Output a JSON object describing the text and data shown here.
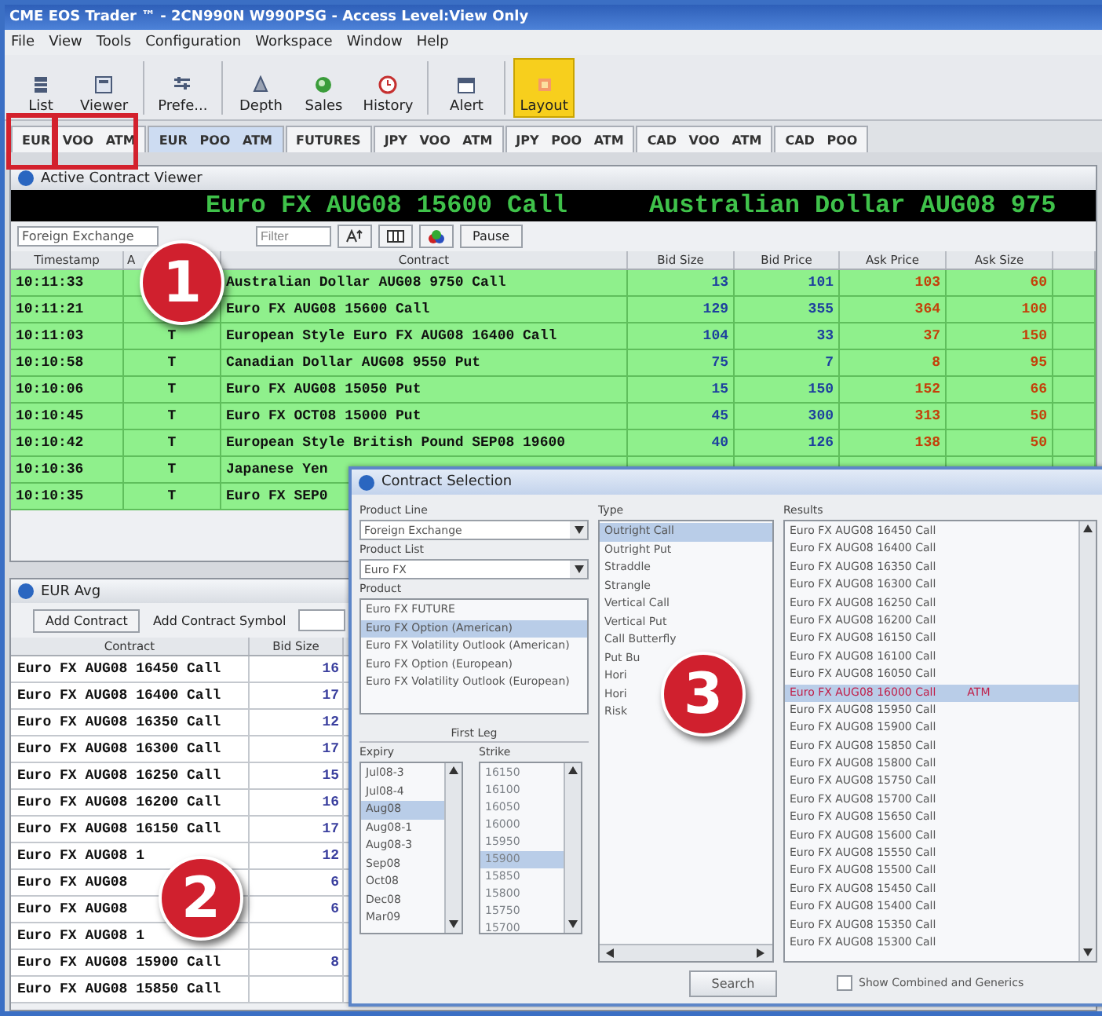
{
  "window": {
    "title": "CME EOS Trader ™ - 2CN990N W990PSG - Access Level:View Only"
  },
  "menu": [
    "File",
    "View",
    "Tools",
    "Configuration",
    "Workspace",
    "Window",
    "Help"
  ],
  "toolbar": [
    {
      "label": "List",
      "kind": "list",
      "selected": false
    },
    {
      "label": "Viewer",
      "kind": "viewer",
      "selected": false
    },
    {
      "label": "Prefe...",
      "kind": "prefs",
      "selected": false
    },
    {
      "label": "Depth",
      "kind": "depth",
      "selected": false
    },
    {
      "label": "Sales",
      "kind": "sales",
      "selected": false
    },
    {
      "label": "History",
      "kind": "history",
      "selected": false
    },
    {
      "label": "Alert",
      "kind": "alert",
      "selected": false
    },
    {
      "label": "Layout",
      "kind": "layout",
      "selected": true
    }
  ],
  "tabs": [
    {
      "label": "EUR VOO ATM",
      "selected": false
    },
    {
      "label": "EUR POO ATM",
      "selected": true
    },
    {
      "label": "FUTURES",
      "selected": false
    },
    {
      "label": "JPY VOO ATM",
      "selected": false
    },
    {
      "label": "JPY POO ATM",
      "selected": false
    },
    {
      "label": "CAD VOO ATM",
      "selected": false
    },
    {
      "label": "CAD POO",
      "selected": false
    }
  ],
  "callouts": [
    "1",
    "2",
    "3"
  ],
  "contract_viewer": {
    "title": "Active Contract Viewer",
    "ticker": [
      "Euro FX AUG08 15600 Call",
      "Australian Dollar AUG08 975"
    ],
    "product_line": "Foreign Exchange",
    "filter": {
      "placeholder": "Filter"
    },
    "pause_button": "Pause",
    "columns": [
      "Timestamp",
      "A",
      "Contract",
      "Bid Size",
      "Bid Price",
      "Ask Price",
      "Ask Size"
    ],
    "rows": [
      {
        "timestamp": "10:11:33",
        "contract": "Australian Dollar AUG08 9750 Call",
        "bid_size": "13",
        "bid_price": "101",
        "ask_price": "103",
        "ask_size": "60"
      },
      {
        "timestamp": "10:11:21",
        "contract": "Euro FX AUG08 15600 Call",
        "bid_size": "129",
        "bid_price": "355",
        "ask_price": "364",
        "ask_size": "100"
      },
      {
        "timestamp": "10:11:03",
        "action": "T",
        "contract": "European Style Euro FX AUG08 16400 Call",
        "bid_size": "104",
        "bid_price": "33",
        "ask_price": "37",
        "ask_size": "150"
      },
      {
        "timestamp": "10:10:58",
        "action": "T",
        "contract": "Canadian Dollar AUG08 9550 Put",
        "bid_size": "75",
        "bid_price": "7",
        "ask_price": "8",
        "ask_size": "95"
      },
      {
        "timestamp": "10:10:06",
        "action": "T",
        "contract": "Euro FX AUG08 15050 Put",
        "bid_size": "15",
        "bid_price": "150",
        "ask_price": "152",
        "ask_size": "66"
      },
      {
        "timestamp": "10:10:45",
        "action": "T",
        "contract": "Euro FX OCT08 15000 Put",
        "bid_size": "45",
        "bid_price": "300",
        "ask_price": "313",
        "ask_size": "50"
      },
      {
        "timestamp": "10:10:42",
        "action": "T",
        "contract": "European Style British Pound SEP08 19600",
        "bid_size": "40",
        "bid_price": "126",
        "ask_price": "138",
        "ask_size": "50"
      },
      {
        "timestamp": "10:10:36",
        "action": "T",
        "contract": "Japanese Yen"
      },
      {
        "timestamp": "10:10:35",
        "action": "T",
        "contract": "Euro FX SEP0"
      }
    ]
  },
  "eur_avg": {
    "title": "EUR Avg",
    "add_contract_button": "Add Contract",
    "add_symbol_label": "Add Contract Symbol",
    "columns": [
      "Contract",
      "Bid Size"
    ],
    "rows": [
      {
        "contract": "Euro FX AUG08 16450 Call",
        "bid_size": "16"
      },
      {
        "contract": "Euro FX AUG08 16400 Call",
        "bid_size": "17"
      },
      {
        "contract": "Euro FX AUG08 16350 Call",
        "bid_size": "12"
      },
      {
        "contract": "Euro FX AUG08 16300 Call",
        "bid_size": "17"
      },
      {
        "contract": "Euro FX AUG08 16250 Call",
        "bid_size": "15"
      },
      {
        "contract": "Euro FX AUG08 16200 Call",
        "bid_size": "16"
      },
      {
        "contract": "Euro FX AUG08 16150 Call",
        "bid_size": "17"
      },
      {
        "contract": "Euro FX AUG08 1",
        "bid_size": "12"
      },
      {
        "contract": "Euro FX AUG08",
        "bid_size": "6"
      },
      {
        "contract": "Euro FX AUG08",
        "bid_size": "6"
      },
      {
        "contract": "Euro FX AUG08 1"
      },
      {
        "contract": "Euro FX AUG08 15900 Call",
        "bid_size": "8"
      },
      {
        "contract": "Euro FX AUG08 15850 Call"
      }
    ]
  },
  "contract_selection": {
    "title": "Contract Selection",
    "product_line_label": "Product Line",
    "product_line": "Foreign Exchange",
    "product_list_label": "Product List",
    "product_list": "Euro FX",
    "product_label": "Product",
    "products": [
      {
        "label": "Euro FX FUTURE",
        "selected": false
      },
      {
        "label": "Euro FX Option (American)",
        "selected": true
      },
      {
        "label": "Euro FX Volatility Outlook (American)",
        "selected": false
      },
      {
        "label": "Euro FX Option (European)",
        "selected": false
      },
      {
        "label": "Euro FX Volatility Outlook (European)",
        "selected": false
      }
    ],
    "first_leg_label": "First Leg",
    "expiry_label": "Expiry",
    "strike_label": "Strike",
    "expiries": [
      {
        "label": "Jul08-3",
        "selected": false
      },
      {
        "label": "Jul08-4",
        "selected": false
      },
      {
        "label": "Aug08",
        "selected": true
      },
      {
        "label": "Aug08-1",
        "selected": false
      },
      {
        "label": "Aug08-3",
        "selected": false
      },
      {
        "label": "Sep08",
        "selected": false
      },
      {
        "label": "Oct08",
        "selected": false
      },
      {
        "label": "Dec08",
        "selected": false
      },
      {
        "label": "Mar09",
        "selected": false
      }
    ],
    "strikes_disabled": true,
    "strikes": [
      {
        "label": "16150",
        "selected": false
      },
      {
        "label": "16100",
        "selected": false
      },
      {
        "label": "16050",
        "selected": false
      },
      {
        "label": "16000",
        "selected": false
      },
      {
        "label": "15950",
        "selected": false
      },
      {
        "label": "15900",
        "selected": true
      },
      {
        "label": "15850",
        "selected": false
      },
      {
        "label": "15800",
        "selected": false
      },
      {
        "label": "15750",
        "selected": false
      },
      {
        "label": "15700",
        "selected": false
      }
    ],
    "type_label": "Type",
    "types": [
      {
        "label": "Outright Call",
        "selected": true
      },
      {
        "label": "Outright Put",
        "selected": false
      },
      {
        "label": "Straddle",
        "selected": false
      },
      {
        "label": "Strangle",
        "selected": false
      },
      {
        "label": "Vertical Call",
        "selected": false
      },
      {
        "label": "Vertical Put",
        "selected": false
      },
      {
        "label": "Call Butterfly",
        "selected": false
      },
      {
        "label": "Put Bu",
        "selected": false
      },
      {
        "label": "Hori",
        "selected": false
      },
      {
        "label": "Hori",
        "selected": false
      },
      {
        "label": "Risk",
        "selected": false
      }
    ],
    "results_label": "Results",
    "results": [
      {
        "label": "Euro FX AUG08 16450 Call",
        "selected": false
      },
      {
        "label": "Euro FX AUG08 16400 Call",
        "selected": false
      },
      {
        "label": "Euro FX AUG08 16350 Call",
        "selected": false
      },
      {
        "label": "Euro FX AUG08 16300 Call",
        "selected": false
      },
      {
        "label": "Euro FX AUG08 16250 Call",
        "selected": false
      },
      {
        "label": "Euro FX AUG08 16200 Call",
        "selected": false
      },
      {
        "label": "Euro FX AUG08 16150 Call",
        "selected": false
      },
      {
        "label": "Euro FX AUG08 16100 Call",
        "selected": false
      },
      {
        "label": "Euro FX AUG08 16050 Call",
        "selected": false
      },
      {
        "label": "Euro FX AUG08 16000 Call",
        "selected": true,
        "tag": "ATM"
      },
      {
        "label": "Euro FX AUG08 15950 Call",
        "selected": false
      },
      {
        "label": "Euro FX AUG08 15900 Call",
        "selected": false
      },
      {
        "label": "Euro FX AUG08 15850 Call",
        "selected": false
      },
      {
        "label": "Euro FX AUG08 15800 Call",
        "selected": false
      },
      {
        "label": "Euro FX AUG08 15750 Call",
        "selected": false
      },
      {
        "label": "Euro FX AUG08 15700 Call",
        "selected": false
      },
      {
        "label": "Euro FX AUG08 15650 Call",
        "selected": false
      },
      {
        "label": "Euro FX AUG08 15600 Call",
        "selected": false
      },
      {
        "label": "Euro FX AUG08 15550 Call",
        "selected": false
      },
      {
        "label": "Euro FX AUG08 15500 Call",
        "selected": false
      },
      {
        "label": "Euro FX AUG08 15450 Call",
        "selected": false
      },
      {
        "label": "Euro FX AUG08 15400 Call",
        "selected": false
      },
      {
        "label": "Euro FX AUG08 15350 Call",
        "selected": false
      },
      {
        "label": "Euro FX AUG08 15300 Call",
        "selected": false
      }
    ],
    "search_button": "Search",
    "show_combined": {
      "label": "Show Combined and Generics",
      "checked": false
    }
  }
}
